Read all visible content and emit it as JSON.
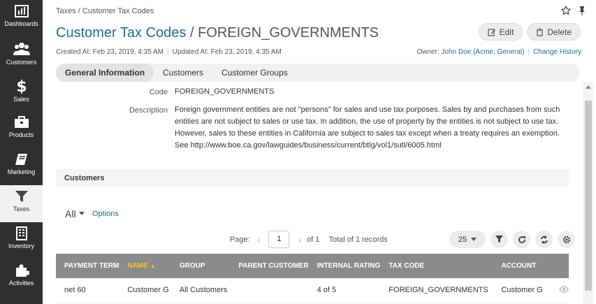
{
  "sidebar": {
    "items": [
      {
        "label": "Dashboards",
        "icon": "bar-chart-icon",
        "active": false
      },
      {
        "label": "Customers",
        "icon": "users-icon",
        "active": false
      },
      {
        "label": "Sales",
        "icon": "dollar-icon",
        "active": false
      },
      {
        "label": "Products",
        "icon": "briefcase-icon",
        "active": false
      },
      {
        "label": "Marketing",
        "icon": "book-icon",
        "active": false
      },
      {
        "label": "Taxes",
        "icon": "filter-icon",
        "active": true
      },
      {
        "label": "Inventory",
        "icon": "building-icon",
        "active": false
      },
      {
        "label": "Activities",
        "icon": "puzzle-icon",
        "active": false
      }
    ]
  },
  "header": {
    "breadcrumb": "Taxes / Customer Tax Codes",
    "entity_title": "Customer Tax Codes",
    "title_sep": "/",
    "record_title": "FOREIGN_GOVERNMENTS",
    "edit_label": "Edit",
    "delete_label": "Delete",
    "created": "Created At: Feb 23, 2019, 4:35 AM",
    "updated": "Updated At: Feb 23, 2019, 4:35 AM",
    "owner_label": "Owner:",
    "owner": "John Doe (Acme, General)",
    "change_history": "Change History"
  },
  "tabs": [
    "General Information",
    "Customers",
    "Customer Groups"
  ],
  "fields": {
    "code_label": "Code",
    "code": "FOREIGN_GOVERNMENTS",
    "description_label": "Description",
    "description_lines": [
      "Foreign government entities are not \"persons\" for sales and use tax purposes. Sales by and purchases from such",
      "entities are not subject to sales or use tax. In addition, the use of property by the entities is not subject to use tax.",
      "However, sales to these entities in California are subject to sales tax except when a treaty requires an exemption.",
      "See http://www.boe.ca.gov/lawguides/business/current/btlg/vol1/sutl/6005.html"
    ]
  },
  "customers_section": {
    "title": "Customers",
    "view": "All",
    "options_label": "Options",
    "page_label": "Page:",
    "page": "1",
    "of_label": "of 1",
    "total": "Total of 1 records",
    "per_page": "25"
  },
  "table": {
    "columns": [
      "PAYMENT TERM",
      "NAME",
      "GROUP",
      "PARENT CUSTOMER",
      "INTERNAL RATING",
      "TAX CODE",
      "ACCOUNT",
      ""
    ],
    "rows": [
      [
        "net 60",
        "Customer G",
        "All Customers",
        "",
        "4 of 5",
        "FOREIGN_GOVERNMENTS",
        "Customer G"
      ]
    ]
  },
  "colors": {
    "accent": "#1f6e8c",
    "sidebar": "#2f2f2f",
    "sort_active": "#f4c430"
  }
}
